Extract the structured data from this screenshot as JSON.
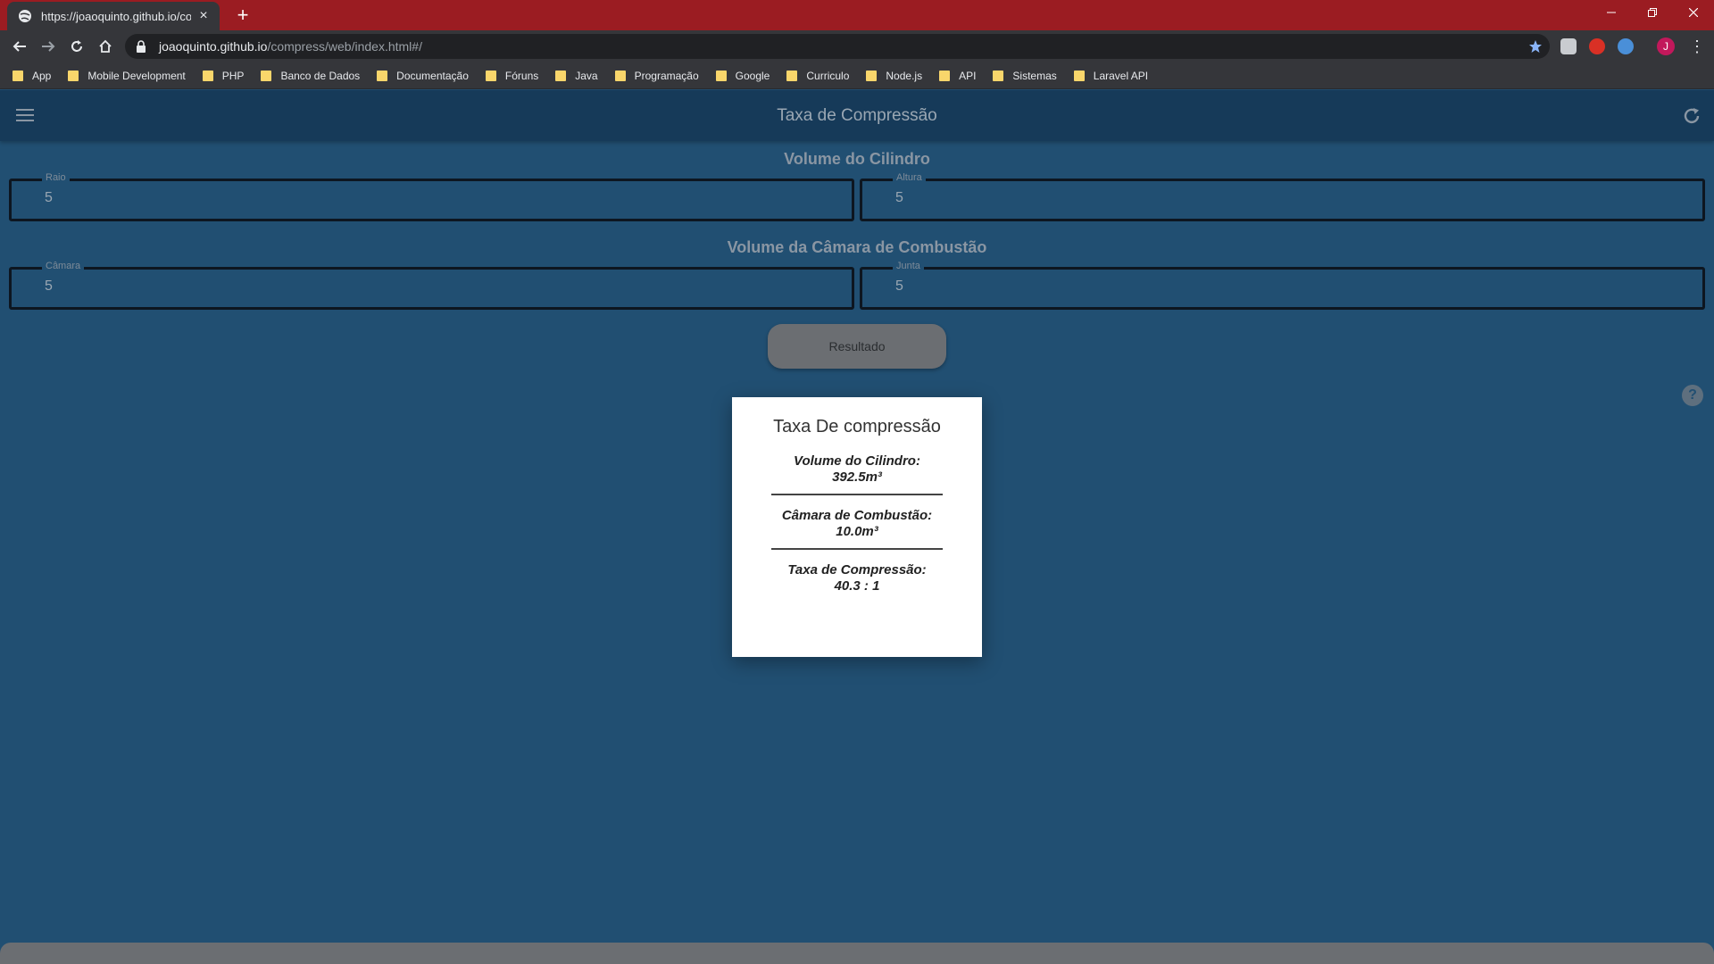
{
  "browser": {
    "tab_title": "https://joaoquinto.github.io/com",
    "url_host": "joaoquinto.github.io",
    "url_path": "/compress/web/index.html#/",
    "profile_initial": "J"
  },
  "bookmarks": [
    "App",
    "Mobile Development",
    "PHP",
    "Banco de Dados",
    "Documentação",
    "Fóruns",
    "Java",
    "Programação",
    "Google",
    "Curriculo",
    "Node.js",
    "API",
    "Sistemas",
    "Laravel API"
  ],
  "app": {
    "title": "Taxa de Compressão",
    "cylinder_section": "Volume do Cilindro",
    "chamber_section": "Volume da Câmara de Combustão",
    "raio_label": "Raio",
    "raio_value": "5",
    "altura_label": "Altura",
    "altura_value": "5",
    "camara_label": "Câmara",
    "camara_value": "5",
    "junta_label": "Junta",
    "junta_value": "5",
    "result_button": "Resultado"
  },
  "result": {
    "title": "Taxa De compressão",
    "cylinder_label": "Volume do Cilindro:",
    "cylinder_value": "392.5m³",
    "chamber_label": "Câmara de Combustão:",
    "chamber_value": "10.0m³",
    "ratio_label": "Taxa de Compressão:",
    "ratio_value": "40.3 : 1"
  }
}
